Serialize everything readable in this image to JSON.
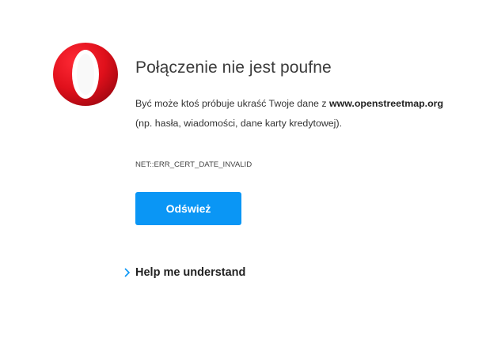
{
  "logo": {
    "icon": "opera-logo-icon",
    "color": "#e0101b"
  },
  "title": "Połączenie nie jest poufne",
  "message": {
    "before": "Być może ktoś próbuje ukraść Twoje dane z ",
    "host": "www.openstreetmap.org",
    "after": " (np. hasła, wiadomości, dane karty kredytowej)."
  },
  "error_code": "NET::ERR_CERT_DATE_INVALID",
  "reload_button": {
    "label": "Odśwież",
    "color": "#0a96f5"
  },
  "help": {
    "label": "Help me understand",
    "icon": "chevron-right-icon",
    "icon_color": "#0a96f5"
  }
}
